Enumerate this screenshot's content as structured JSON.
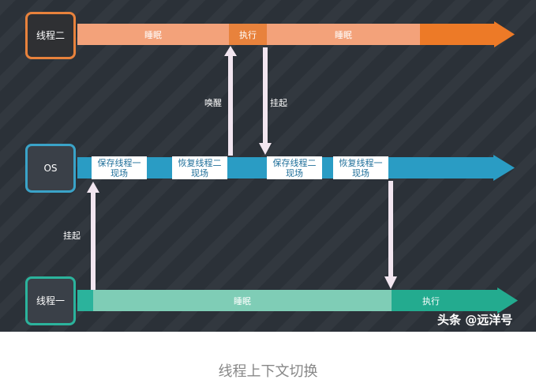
{
  "diagram": {
    "lanes": [
      {
        "id": "thread2",
        "label": "线程二",
        "color": "#e8823c"
      },
      {
        "id": "os",
        "label": "OS",
        "color": "#3aa3c8"
      },
      {
        "id": "thread1",
        "label": "线程一",
        "color": "#2bb39c"
      }
    ],
    "thread2_band": {
      "sleep_1": "睡眠",
      "run": "执行",
      "sleep_2": "睡眠"
    },
    "os_band": {
      "save_thread1": "保存线程一\n现场",
      "restore_thread2": "恢复线程二\n现场",
      "save_thread2": "保存线程二\n现场",
      "restore_thread1": "恢复线程一\n现场"
    },
    "thread1_band": {
      "sleep": "睡眠",
      "run": "执行"
    },
    "arrows": {
      "wake": "唤醒",
      "suspend_thread2": "挂起",
      "suspend_thread1": "挂起"
    },
    "watermark": "头条 @远洋号"
  },
  "caption": "线程上下文切换"
}
